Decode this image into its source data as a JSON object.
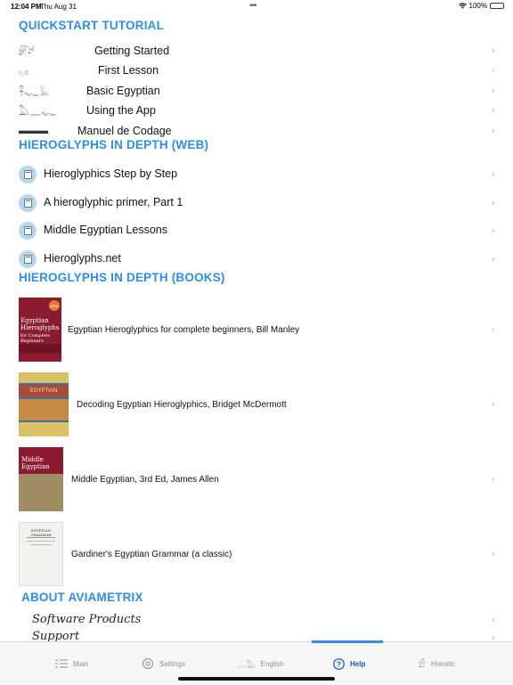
{
  "status": {
    "time": "12:04 PM",
    "date": "Thu Aug 31",
    "battery": "100%"
  },
  "quickstart": {
    "header": "QUICKSTART TUTORIAL",
    "items": [
      {
        "label": "Getting Started",
        "glyphs": "𓏞𓃾"
      },
      {
        "label": "First Lesson",
        "glyphs": "𓏤𓂂𓏤𓏤"
      },
      {
        "label": "Basic Egyptian",
        "glyphs": "𓋹𓆑𓄿"
      },
      {
        "label": "Using the App",
        "glyphs": "𓅓𓈖𓆑"
      },
      {
        "label": "Manuel de Codage",
        "glyphs": "▬▬▬"
      }
    ]
  },
  "web": {
    "header": "HIEROGLYPHS IN DEPTH (WEB)",
    "items": [
      {
        "label": "Hieroglyphics Step by Step"
      },
      {
        "label": "A hieroglyphic primer, Part 1"
      },
      {
        "label": "Middle Egyptian Lessons"
      },
      {
        "label": "Hieroglyphs.net"
      }
    ]
  },
  "books": {
    "header": "HIEROGLYPHS IN DEPTH (BOOKS)",
    "items": [
      {
        "label": "Egyptian Hieroglyphics for complete beginners, Bill Manley",
        "cover_title": "Egyptian Hieroglyphs",
        "cover_sub": "for Complete Beginners",
        "cover_badge": "NEW",
        "color": "#8b1b2e"
      },
      {
        "label": "Decoding Egyptian Hieroglyphics, Bridget McDermott",
        "cover_title": "EGYPTIAN",
        "color": "#3f6f9b"
      },
      {
        "label": "Middle Egyptian, 3rd Ed, James Allen",
        "cover_title": "Middle Egyptian",
        "color": "#8b1b2e"
      },
      {
        "label": "Gardiner's Egyptian Grammar (a classic)",
        "cover_title": "EGYPTIAN GRAMMAR",
        "color": "#f2f2ee"
      }
    ]
  },
  "about": {
    "header": "ABOUT AVIAMETRIX",
    "items": [
      {
        "label": "Software Products"
      },
      {
        "label": "Support"
      }
    ]
  },
  "tabs": [
    {
      "label": "Main",
      "icon": "list-icon",
      "active": false
    },
    {
      "label": "Settings",
      "icon": "gear-icon",
      "active": false
    },
    {
      "label": "English",
      "icon": "hieroglyph-icon",
      "active": false
    },
    {
      "label": "Help",
      "icon": "question-icon",
      "active": true
    },
    {
      "label": "Hieratic",
      "icon": "hieratic-icon",
      "active": false
    }
  ],
  "colors": {
    "accent": "#2f8ee4",
    "active_tab": "#1f4fbf",
    "chevron": "#b7b7bb"
  }
}
